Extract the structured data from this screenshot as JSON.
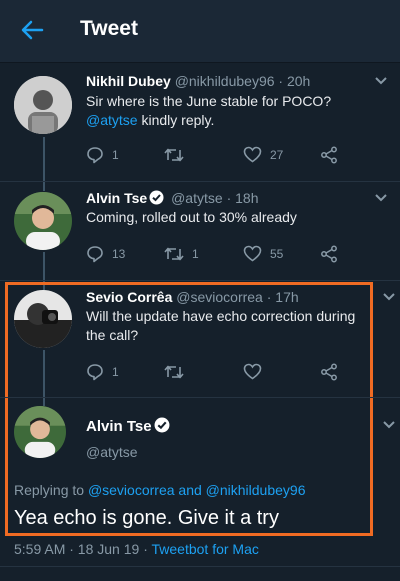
{
  "header": {
    "title": "Tweet"
  },
  "tweets": [
    {
      "name": "Nikhil Dubey",
      "handle": "@nikhildubey96",
      "time": "20h",
      "text_before": "Sir where is the June stable for POCO?",
      "mention": "@atytse",
      "text_after": "kindly reply.",
      "replies": "1",
      "retweets": "",
      "likes": "27"
    },
    {
      "name": "Alvin Tse",
      "handle": "@atytse",
      "time": "18h",
      "text": "Coming, rolled out to 30% already",
      "replies": "13",
      "retweets": "1",
      "likes": "55"
    },
    {
      "name": "Sevio Corrêa",
      "handle": "@seviocorrea",
      "time": "17h",
      "text": "Will the update have echo correction during the call?",
      "replies": "1",
      "retweets": "",
      "likes": ""
    }
  ],
  "main_tweet": {
    "name": "Alvin Tse",
    "handle": "@atytse",
    "replying_label": "Replying to",
    "replying_to_1": "@seviocorrea",
    "replying_and": "and",
    "replying_to_2": "@nikhildubey96",
    "text": "Yea echo is gone. Give it a try",
    "timestamp": "5:59 AM · 18 Jun 19 ·",
    "app": "Tweetbot for Mac"
  },
  "separator": "·",
  "colors": {
    "background": "#15202b",
    "accent": "#1da1f2",
    "highlight": "#f06b23"
  },
  "icons": [
    "back-arrow-icon",
    "verified-icon",
    "chevron-down-icon",
    "reply-icon",
    "retweet-icon",
    "like-icon",
    "share-icon"
  ]
}
